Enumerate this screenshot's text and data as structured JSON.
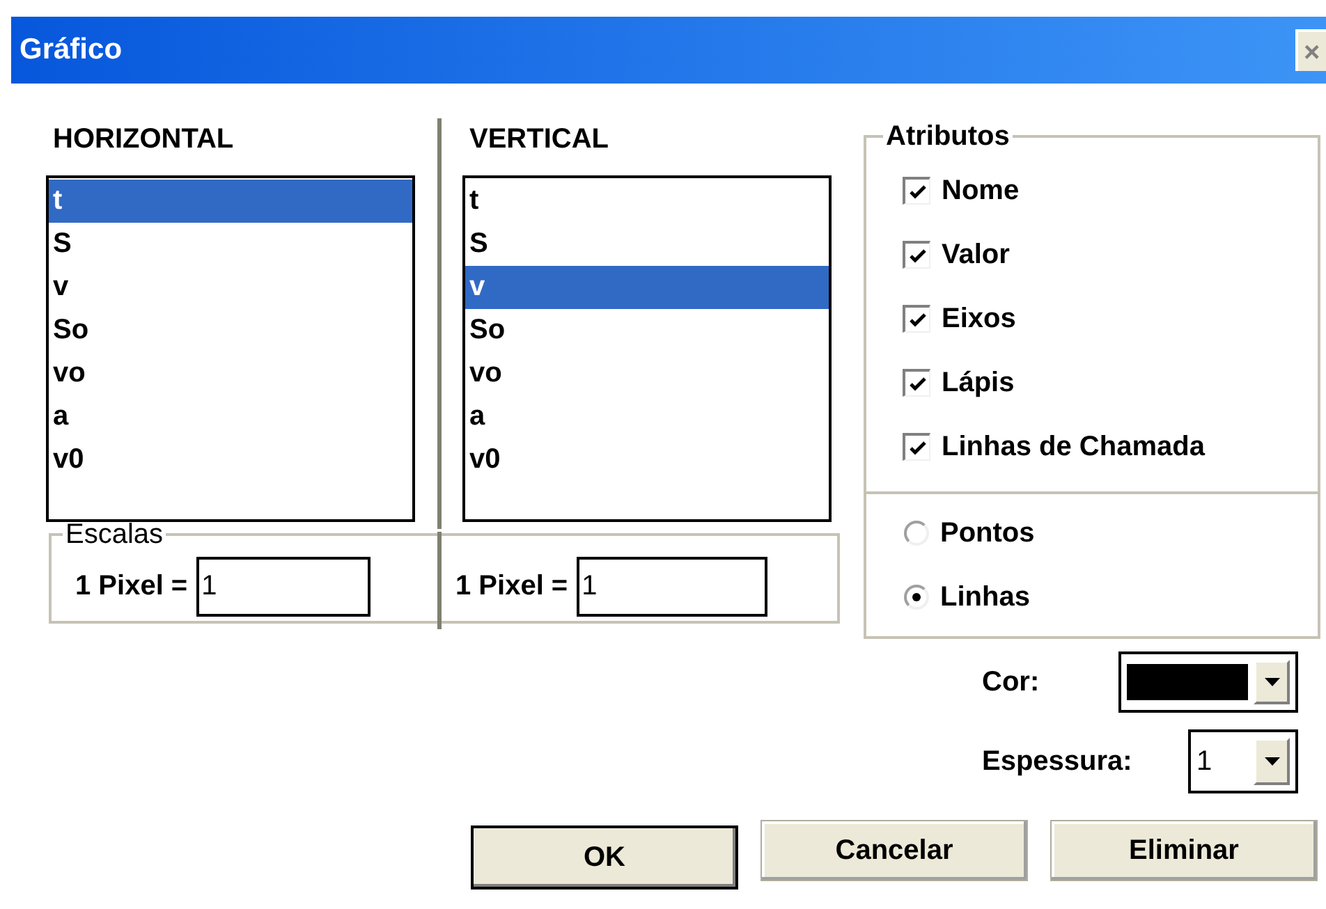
{
  "window": {
    "title": "Gráfico",
    "close": "×"
  },
  "axes": [
    {
      "heading": "HORIZONTAL",
      "items": [
        {
          "label": "t",
          "selected": true
        },
        {
          "label": "S",
          "selected": false
        },
        {
          "label": "v",
          "selected": false
        },
        {
          "label": "So",
          "selected": false
        },
        {
          "label": "vo",
          "selected": false
        },
        {
          "label": "a",
          "selected": false
        },
        {
          "label": "v0",
          "selected": false
        }
      ],
      "scale_label": "1 Pixel =",
      "scale_value": "1"
    },
    {
      "heading": "VERTICAL",
      "items": [
        {
          "label": "t",
          "selected": false
        },
        {
          "label": "S",
          "selected": false
        },
        {
          "label": "v",
          "selected": true
        },
        {
          "label": "So",
          "selected": false
        },
        {
          "label": "vo",
          "selected": false
        },
        {
          "label": "a",
          "selected": false
        },
        {
          "label": "v0",
          "selected": false
        }
      ],
      "scale_label": "1 Pixel =",
      "scale_value": "1"
    }
  ],
  "scales_title": "Escalas",
  "attributes": {
    "title": "Atributos",
    "checkboxes": [
      {
        "label": "Nome",
        "checked": true
      },
      {
        "label": "Valor",
        "checked": true
      },
      {
        "label": "Eixos",
        "checked": true
      },
      {
        "label": "Lápis",
        "checked": true
      },
      {
        "label": "Linhas de Chamada",
        "checked": true
      }
    ],
    "radios": [
      {
        "label": "Pontos",
        "selected": false
      },
      {
        "label": "Linhas",
        "selected": true
      }
    ]
  },
  "color_field": {
    "label": "Cor:",
    "color": "#000000"
  },
  "thickness_field": {
    "label": "Espessura:",
    "value": "1"
  },
  "buttons": [
    {
      "label": "OK",
      "default": true
    },
    {
      "label": "Cancelar",
      "default": false
    },
    {
      "label": "Eliminar",
      "default": false
    }
  ]
}
